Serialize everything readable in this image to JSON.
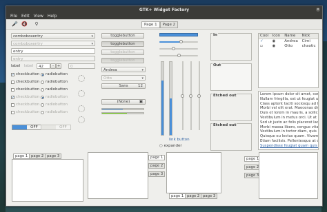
{
  "window": {
    "title": "GTK+ Widget Factory",
    "close_glyph": "×"
  },
  "menu": [
    "File",
    "Edit",
    "View",
    "Help"
  ],
  "top_tabs": [
    "Page 1",
    "Page 2"
  ],
  "combos": [
    {
      "value": "comboboxentry",
      "enabled": true
    },
    {
      "value": "comboboxentry",
      "enabled": false
    },
    {
      "value": "entry",
      "enabled": true
    },
    {
      "value": "entry",
      "enabled": false
    }
  ],
  "spin": {
    "label": "label",
    "label_disabled": "label",
    "value": "42",
    "minus": "-",
    "plus": "+",
    "value_disabled": "0"
  },
  "checks": [
    {
      "check_label": "checkbutton",
      "checked": true,
      "radio_label": "radiobutton",
      "radio_on": true,
      "enabled": true
    },
    {
      "check_label": "checkbutton",
      "checked": false,
      "radio_label": "radiobutton",
      "radio_on": false,
      "enabled": true
    },
    {
      "check_label": "checkbutton",
      "checked": false,
      "radio_label": "radiobutton",
      "radio_on": false,
      "enabled": true
    },
    {
      "check_label": "checkbutton",
      "checked": true,
      "radio_label": "radiobutton",
      "radio_on": true,
      "enabled": false
    },
    {
      "check_label": "checkbutton",
      "checked": false,
      "radio_label": "radiobutton",
      "radio_on": false,
      "enabled": false
    },
    {
      "check_label": "checkbutton",
      "checked": false,
      "radio_label": "radiobutton",
      "radio_on": false,
      "enabled": false
    }
  ],
  "switches": {
    "on_label": "OFF",
    "off_label": "OFF"
  },
  "toggle_buttons": [
    "togglebutton",
    "togglebutton",
    "togglebutton",
    "togglebutton"
  ],
  "font_combos": {
    "first": "Andrea",
    "second": "Otto"
  },
  "font_button": {
    "family": "Sans",
    "size": "12"
  },
  "color_button": {
    "label": "(None)"
  },
  "progress": {
    "fill": 0.5
  },
  "scales": {
    "h1": 0.55,
    "h2": 0.35,
    "h3": 0.5
  },
  "vbars": {
    "v1": 0.75,
    "v2": 0.5
  },
  "link_button": "link button",
  "expander": "expander",
  "frames": [
    "In",
    "Out",
    "Etched out",
    "Etched out"
  ],
  "tree": {
    "headers": [
      "Cool",
      "Icon",
      "Name",
      "Nick"
    ],
    "rows": [
      {
        "cool": true,
        "icon": "person-icon",
        "name": "Andrea",
        "nick": "Cimi"
      },
      {
        "cool": false,
        "icon": "person-icon",
        "name": "Otto",
        "nick": "chaotic"
      }
    ]
  },
  "text_lines": [
    "Lorem ipsum dolor sit amet, conse",
    "Nullam fringilla, est ut feugiat ult",
    "Class aptent taciti sociosqu ad lit",
    "Morbi vel elit erat. Maecenas digni",
    "Duis et lorem in mauris, a sollicitu",
    "Vestibulum in metus orci. Ut at",
    "Sed ut justo ac felis placerat laore",
    "Morbi massa libero, congue vitae so",
    "Vestibulum in tortor diam, quis aliq",
    "Quisque eu lectus quam. Vivamus eget",
    "Etiam facilisis. Pellentesque at dolor",
    "Suspendisse feugiat quam quis do"
  ],
  "notebooks": {
    "top": [
      "page 1",
      "page 2",
      "page 3"
    ],
    "right": [
      "page 1",
      "page 2",
      "page 3"
    ],
    "bottom": [
      "page 1",
      "page 2",
      "page 3"
    ],
    "left": [
      "page 1",
      "page 2",
      "page 3"
    ]
  },
  "colors": {
    "accent": "#4a90d9",
    "titlebar": "#3b3b38",
    "window_bg": "#efefec"
  }
}
